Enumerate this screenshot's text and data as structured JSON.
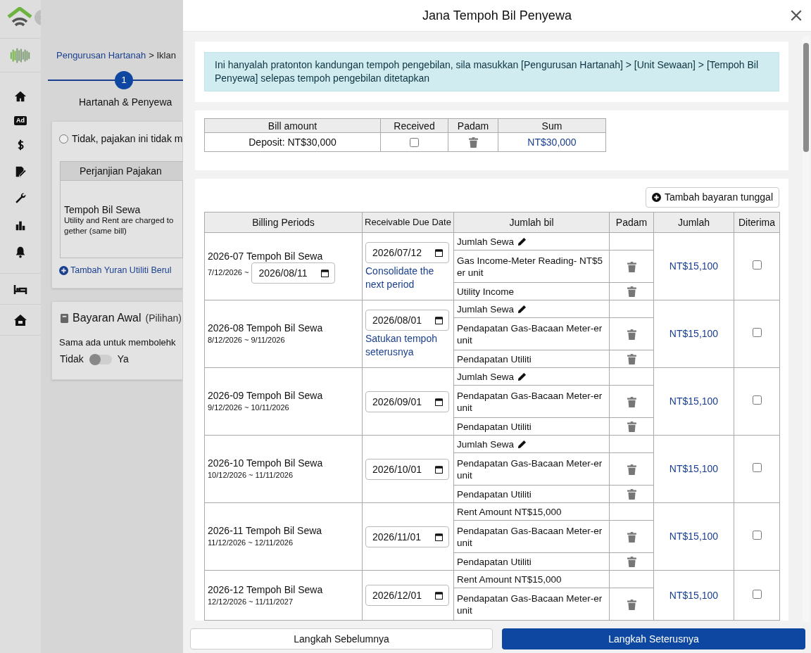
{
  "sidebar": {
    "ad_label": "Ad"
  },
  "background_page": {
    "breadcrumb": {
      "link": "Pengurusan Hartanah",
      "rest": "> Iklan"
    },
    "step": {
      "number": "1",
      "label": "Hartanah & Penyewa"
    },
    "lease_option": {
      "label": "Tidak, pajakan ini tidak m",
      "selected": false
    },
    "agreement_table": {
      "header": "Perjanjian Pajakan",
      "title": "Tempoh Bil Sewa",
      "note": "Utility and Rent are charged to gether (same bill)"
    },
    "add_utility_link": "Tambah Yuran Utiliti Berul",
    "advance_payment": {
      "title": "Bayaran Awal",
      "optional": "(Pilihan)",
      "question": "Sama ada untuk membolehk",
      "off_label": "Tidak",
      "on_label": "Ya",
      "on": false
    }
  },
  "modal": {
    "title": "Jana Tempoh Bil Penyewa",
    "notice": "Ini hanyalah pratonton kandungan tempoh pengebilan, sila masukkan [Pengurusan Hartanah] > [Unit Sewaan] > [Tempoh Bil Penyewa] selepas tempoh pengebilan ditetapkan",
    "deposit_table": {
      "columns": [
        "Bill amount",
        "Received",
        "Padam",
        "Sum"
      ],
      "rows": [
        {
          "bill_amount": "Deposit: NT$30,000",
          "received": false,
          "sum": "NT$30,000"
        }
      ]
    },
    "add_single_payment_button": "Tambah bayaran tunggal",
    "billing_table": {
      "columns": [
        "Billing Periods",
        "Receivable Due Date",
        "Jumlah bil",
        "Padam",
        "Jumlah",
        "Diterima"
      ],
      "rows": [
        {
          "period": "2026-07 Tempoh Bil Sewa",
          "range": "7/12/2026 ~",
          "range_end": "2026/08/11",
          "due_date": "2026/07/12",
          "due_note": "Consolidate the next period",
          "items": [
            {
              "label": "Jumlah Sewa",
              "editable": true,
              "deletable": false
            },
            {
              "label": "Gas Income-Meter Reading- NT$5 er unit",
              "editable": false,
              "deletable": true
            },
            {
              "label": "Utility Income",
              "editable": false,
              "deletable": true
            }
          ],
          "total": "NT$15,100",
          "received": false
        },
        {
          "period": "2026-08 Tempoh Bil Sewa",
          "range": "8/12/2026 ~ 9/11/2026",
          "due_date": "2026/08/01",
          "due_note": "Satukan tempoh seterusnya",
          "items": [
            {
              "label": "Jumlah Sewa",
              "editable": true,
              "deletable": false
            },
            {
              "label": "Pendapatan Gas-Bacaan Meter-er unit",
              "editable": false,
              "deletable": true
            },
            {
              "label": "Pendapatan Utiliti",
              "editable": false,
              "deletable": true
            }
          ],
          "total": "NT$15,100",
          "received": false
        },
        {
          "period": "2026-09 Tempoh Bil Sewa",
          "range": "9/12/2026 ~ 10/11/2026",
          "due_date": "2026/09/01",
          "items": [
            {
              "label": "Jumlah Sewa",
              "editable": true,
              "deletable": false
            },
            {
              "label": "Pendapatan Gas-Bacaan Meter-er unit",
              "editable": false,
              "deletable": true
            },
            {
              "label": "Pendapatan Utiliti",
              "editable": false,
              "deletable": true
            }
          ],
          "total": "NT$15,100",
          "received": false
        },
        {
          "period": "2026-10 Tempoh Bil Sewa",
          "range": "10/12/2026 ~ 11/11/2026",
          "due_date": "2026/10/01",
          "items": [
            {
              "label": "Jumlah Sewa",
              "editable": true,
              "deletable": false
            },
            {
              "label": "Pendapatan Gas-Bacaan Meter-er unit",
              "editable": false,
              "deletable": true
            },
            {
              "label": "Pendapatan Utiliti",
              "editable": false,
              "deletable": true
            }
          ],
          "total": "NT$15,100",
          "received": false
        },
        {
          "period": "2026-11 Tempoh Bil Sewa",
          "range": "11/12/2026 ~ 12/11/2026",
          "due_date": "2026/11/01",
          "items": [
            {
              "label": "Rent Amount NT$15,000",
              "editable": false,
              "deletable": false
            },
            {
              "label": "Pendapatan Gas-Bacaan Meter-er unit",
              "editable": false,
              "deletable": true
            },
            {
              "label": "Pendapatan Utiliti",
              "editable": false,
              "deletable": true
            }
          ],
          "total": "NT$15,100",
          "received": false
        },
        {
          "period": "2026-12 Tempoh Bil Sewa",
          "range": "12/12/2026 ~ 11/11/2027",
          "due_date": "2026/12/01",
          "items": [
            {
              "label": "Rent Amount NT$15,000",
              "editable": false,
              "deletable": false
            },
            {
              "label": "Pendapatan Gas-Bacaan Meter-er unit",
              "editable": false,
              "deletable": true
            }
          ],
          "total": "NT$15,100",
          "received": false
        }
      ]
    },
    "footer": {
      "previous_button": "Langkah Sebelumnya",
      "next_button": "Langkah Seterusnya"
    }
  }
}
